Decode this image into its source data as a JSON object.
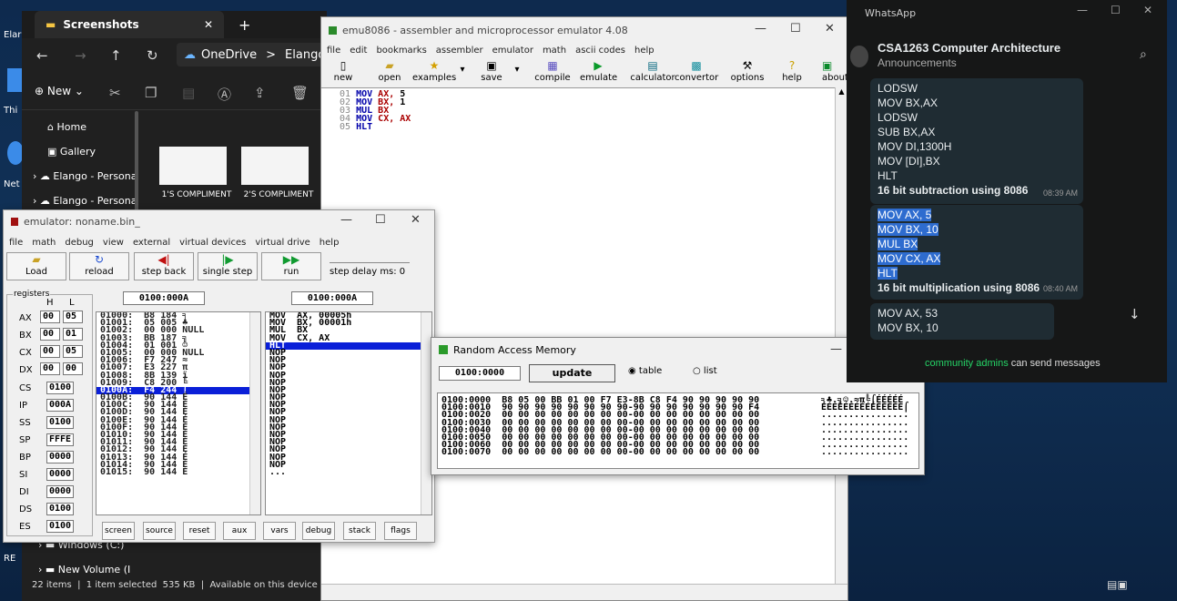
{
  "desktop": {
    "icons": [
      "Elar",
      "Thi",
      "Net",
      "RE"
    ]
  },
  "explorer": {
    "tab": "Screenshots",
    "address": [
      "OneDrive",
      ">",
      "Elango -"
    ],
    "new_label": "New",
    "side": [
      "Home",
      "Gallery",
      "Elango - Persona",
      "Elango - Persona",
      "Windows (C:)",
      "New Volume (I"
    ],
    "thumbs": [
      "1'S COMPLIMENT",
      "2'S COMPLIMENT"
    ],
    "status": "22 items  |  1 item selected  535 KB  |  Available on this device  |"
  },
  "emu": {
    "title": "emu8086 - assembler and microprocessor emulator 4.08",
    "menu": [
      "file",
      "edit",
      "bookmarks",
      "assembler",
      "emulator",
      "math",
      "ascii codes",
      "help"
    ],
    "toolbar": [
      "new",
      "open",
      "examples",
      "save",
      "compile",
      "emulate",
      "calculator",
      "convertor",
      "options",
      "help",
      "about"
    ],
    "lines": [
      {
        "n": "01",
        "op": "MOV",
        "a": "AX,",
        "b": "5"
      },
      {
        "n": "02",
        "op": "MOV",
        "a": "BX,",
        "b": "1"
      },
      {
        "n": "03",
        "op": "MUL",
        "a": "BX",
        "b": ""
      },
      {
        "n": "04",
        "op": "MOV",
        "a": "CX,",
        "b": "AX"
      },
      {
        "n": "05",
        "op": "HLT",
        "a": "",
        "b": ""
      }
    ]
  },
  "emulator": {
    "title": "emulator: noname.bin_",
    "menu": [
      "file",
      "math",
      "debug",
      "view",
      "external",
      "virtual devices",
      "virtual drive",
      "help"
    ],
    "buttons": [
      "Load",
      "reload",
      "step back",
      "single step",
      "run"
    ],
    "step_delay": "step delay ms: 0",
    "registers_label": "registers",
    "H": "H",
    "L": "L",
    "addr_left": "0100:000A",
    "addr_right": "0100:000A",
    "regs8": [
      {
        "n": "AX",
        "h": "00",
        "l": "05"
      },
      {
        "n": "BX",
        "h": "00",
        "l": "01"
      },
      {
        "n": "CX",
        "h": "00",
        "l": "05"
      },
      {
        "n": "DX",
        "h": "00",
        "l": "00"
      }
    ],
    "regs16": [
      {
        "n": "CS",
        "v": "0100"
      },
      {
        "n": "IP",
        "v": "000A"
      },
      {
        "n": "SS",
        "v": "0100"
      },
      {
        "n": "SP",
        "v": "FFFE"
      },
      {
        "n": "BP",
        "v": "0000"
      },
      {
        "n": "SI",
        "v": "0000"
      },
      {
        "n": "DI",
        "v": "0000"
      },
      {
        "n": "DS",
        "v": "0100"
      },
      {
        "n": "ES",
        "v": "0100"
      }
    ],
    "mem": [
      "01000:  B8 184 ╕",
      "01001:  05 005 ♣",
      "01002:  00 000 NULL",
      "01003:  BB 187 ╗",
      "01004:  01 001 ☺",
      "01005:  00 000 NULL",
      "01006:  F7 247 ≈",
      "01007:  E3 227 π",
      "01008:  8B 139 ï",
      "01009:  C8 200 ╚",
      "0100A:  F4 244 ⌠",
      "0100B:  90 144 É",
      "0100C:  90 144 É",
      "0100D:  90 144 É",
      "0100E:  90 144 É",
      "0100F:  90 144 É",
      "01010:  90 144 É",
      "01011:  90 144 É",
      "01012:  90 144 É",
      "01013:  90 144 É",
      "01014:  90 144 É",
      "01015:  90 144 É"
    ],
    "dis": [
      "MOV  AX, 00005h",
      "MOV  BX, 00001h",
      "MUL  BX",
      "MOV  CX, AX",
      "HLT",
      "NOP",
      "NOP",
      "NOP",
      "NOP",
      "NOP",
      "NOP",
      "NOP",
      "NOP",
      "NOP",
      "NOP",
      "NOP",
      "NOP",
      "NOP",
      "NOP",
      "NOP",
      "NOP",
      "..."
    ],
    "bottom": [
      "screen",
      "source",
      "reset",
      "aux",
      "vars",
      "debug",
      "stack",
      "flags"
    ]
  },
  "ram": {
    "title": "Random Access Memory",
    "addr": "0100:0000",
    "update": "update",
    "table": "table",
    "list": "list",
    "rows": [
      "0100:0000  B8 05 00 BB 01 00 F7 E3-8B C8 F4 90 90 90 90 90",
      "0100:0010  90 90 90 90 90 90 90 90-90 90 90 90 90 90 90 F4",
      "0100:0020  00 00 00 00 00 00 00 00-00 00 00 00 00 00 00 00",
      "0100:0030  00 00 00 00 00 00 00 00-00 00 00 00 00 00 00 00",
      "0100:0040  00 00 00 00 00 00 00 00-00 00 00 00 00 00 00 00",
      "0100:0050  00 00 00 00 00 00 00 00-00 00 00 00 00 00 00 00",
      "0100:0060  00 00 00 00 00 00 00 00-00 00 00 00 00 00 00 00",
      "0100:0070  00 00 00 00 00 00 00 00-00 00 00 00 00 00 00 00"
    ],
    "ascii": [
      "╕♣.╗☺.≈π╚⌠ÉÉÉÉÉ",
      "ÉÉÉÉÉÉÉÉÉÉÉÉÉÉÉ⌠",
      "................",
      "................",
      "................",
      "................",
      "................",
      "................"
    ]
  },
  "whatsapp": {
    "app": "WhatsApp",
    "chat": "CSA1263 Computer Architecture",
    "sub": "Announcements",
    "b1": [
      "LODSW",
      "MOV BX,AX",
      "LODSW",
      "SUB BX,AX",
      "MOV DI,1300H",
      "MOV [DI],BX",
      "HLT"
    ],
    "b1_caption": "16 bit subtraction using 8086",
    "b1_time": "08:39 AM",
    "b2": [
      "MOV AX, 5",
      "MOV BX, 10",
      "MUL BX",
      "MOV CX, AX",
      "HLT"
    ],
    "b2_caption": "16 bit multiplication using 8086",
    "b2_time": "08:40 AM",
    "b3": [
      "MOV AX, 53",
      "MOV BX, 10"
    ],
    "admins_link": "community admins",
    "admins_text": " can send messages"
  }
}
